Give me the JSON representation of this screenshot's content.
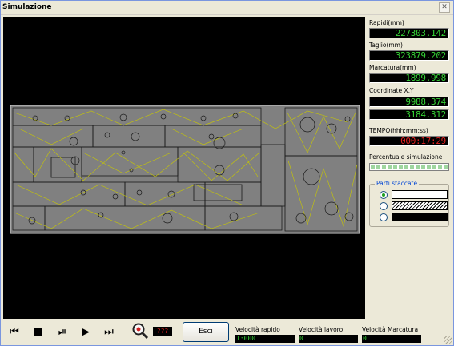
{
  "window": {
    "title": "Simulazione",
    "close_icon": "close-icon"
  },
  "readouts": {
    "rapidi_label": "Rapidi(mm)",
    "rapidi_value": "227303.142",
    "taglio_label": "Taglio(mm)",
    "taglio_value": "323879.202",
    "marcatura_label": "Marcatura(mm)",
    "marcatura_value": "1899.998",
    "coord_label": "Coordinate X,Y",
    "coord_x": "9988.374",
    "coord_y": "3184.312",
    "tempo_label": "TEMPO(hhh:mm:ss)",
    "tempo_value": "000:17:29",
    "percent_label": "Percentuale simulazione",
    "percent_fraction": 1.0
  },
  "parti_staccate": {
    "title": "Parti staccate",
    "options": [
      {
        "style": "white",
        "selected": true
      },
      {
        "style": "hatched",
        "selected": false
      },
      {
        "style": "black",
        "selected": false
      }
    ]
  },
  "controls": {
    "first_icon": "skip-to-start-icon",
    "stop_icon": "stop-icon",
    "step_icon": "step-forward-icon",
    "play_icon": "play-icon",
    "fast_icon": "fast-forward-icon",
    "zoom_icon": "zoom-icon",
    "zoom_value": "???",
    "exit_label": "Esci"
  },
  "speeds": {
    "rapido_label": "Velocità rapido",
    "rapido_value": "13000",
    "lavoro_label": "Velocità lavoro",
    "lavoro_value": "0",
    "marcatura_label": "Velocità Marcatura",
    "marcatura_value": "0"
  },
  "colors": {
    "lcd_green": "#36d436",
    "lcd_red": "#e02020",
    "sheet": "#808080",
    "cut_path": "#c8c800"
  }
}
